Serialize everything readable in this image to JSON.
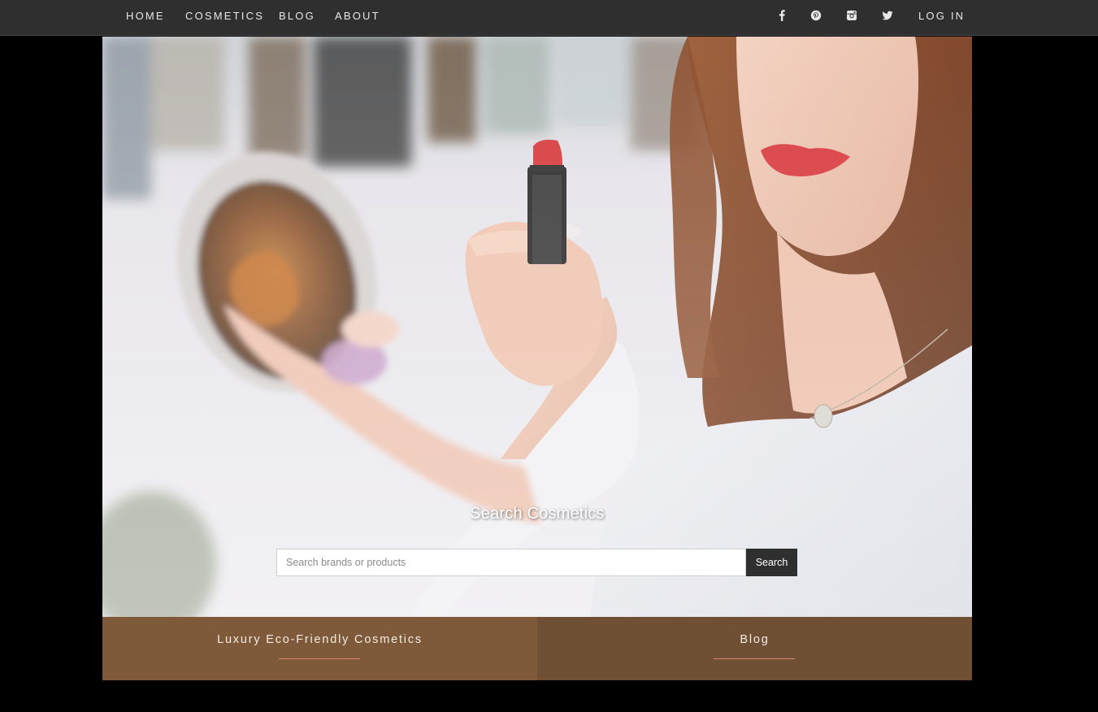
{
  "nav": {
    "links": [
      "HOME",
      "COSMETICS",
      "BLOG",
      "ABOUT"
    ],
    "login": "LOG IN",
    "social_icons": [
      "facebook-icon",
      "pinterest-icon",
      "instagram-icon",
      "twitter-icon"
    ]
  },
  "hero": {
    "title": "Search Cosmetics",
    "search": {
      "placeholder": "Search brands or products",
      "value": "",
      "button": "Search"
    }
  },
  "tiles": [
    {
      "title": "Luxury Eco-Friendly Cosmetics"
    },
    {
      "title": "Blog"
    }
  ],
  "colors": {
    "nav_bg": "#2f2f2f",
    "page_bg": "#000000",
    "tile_left": "#7f5a3a",
    "tile_right": "#705034",
    "accent_underline": "#d9896a",
    "button_bg": "#2f2f2f"
  }
}
